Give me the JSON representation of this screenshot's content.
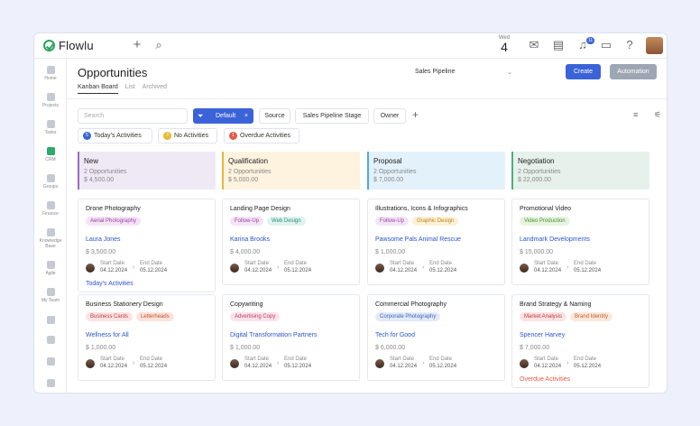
{
  "app": {
    "name": "Flowlu"
  },
  "header": {
    "date_day": "Wed",
    "date_num": "4",
    "notif_count": "11"
  },
  "sidebar": {
    "items": [
      {
        "label": "Home"
      },
      {
        "label": "Projects"
      },
      {
        "label": "Tasks"
      },
      {
        "label": "CRM"
      },
      {
        "label": "Groups"
      },
      {
        "label": "Finance"
      },
      {
        "label": "Knowledge Base"
      },
      {
        "label": "Agile"
      },
      {
        "label": "My Team"
      }
    ]
  },
  "page": {
    "title": "Opportunities",
    "tabs": [
      "Kanban Board",
      "List",
      "Archived"
    ],
    "pipeline": "Sales Pipeline",
    "create_label": "Create",
    "automation_label": "Automation"
  },
  "filters": {
    "search_placeholder": "Search",
    "default_label": "Default",
    "chips": [
      "Source",
      "Sales Pipeline Stage",
      "Owner"
    ]
  },
  "activities": [
    {
      "count": "5",
      "label": "Today's Activities",
      "color": "#3b63d8"
    },
    {
      "count": "3",
      "label": "No Activities",
      "color": "#e5b830"
    },
    {
      "count": "1",
      "label": "Overdue Activities",
      "color": "#e25c4a"
    }
  ],
  "columns": [
    {
      "name": "New",
      "count": "2 Opportunities",
      "total": "$ 4,500.00",
      "bg": "#efe9f6",
      "accent": "#9b6bc8",
      "cards": [
        {
          "title": "Drone Photography",
          "tags": [
            {
              "t": "Aerial Photography",
              "bg": "#f3e4f5",
              "fg": "#9b3fa6"
            }
          ],
          "contact": "Laura Jones",
          "amount": "$ 3,500.00",
          "start": "04.12.2024",
          "end": "05.12.2024",
          "footer": "Today's Activities",
          "footer_color": "#2d55c8"
        },
        {
          "title": "Business Stationery Design",
          "tags": [
            {
              "t": "Business Cards",
              "bg": "#fbe3e3",
              "fg": "#c0393b"
            },
            {
              "t": "Letterheads",
              "bg": "#fbe3dc",
              "fg": "#c04f33"
            }
          ],
          "contact": "Wellness for All",
          "amount": "$ 1,000.00",
          "start": "04.12.2024",
          "end": "05.12.2024",
          "footer": "",
          "footer_color": ""
        }
      ]
    },
    {
      "name": "Qualification",
      "count": "2 Opportunities",
      "total": "$ 5,000.00",
      "bg": "#fdf3de",
      "accent": "#e7b640",
      "cards": [
        {
          "title": "Landing Page Design",
          "tags": [
            {
              "t": "Follow-Up",
              "bg": "#f3e4f5",
              "fg": "#9b3fa6"
            },
            {
              "t": "Web Design",
              "bg": "#dff3ef",
              "fg": "#2a8f7a"
            }
          ],
          "contact": "Karina Brooks",
          "amount": "$ 4,000.00",
          "start": "04.12.2024",
          "end": "05.12.2024",
          "footer": "",
          "footer_color": ""
        },
        {
          "title": "Copywriting",
          "tags": [
            {
              "t": "Advertising Copy",
              "bg": "#fbe3ec",
              "fg": "#c0395e"
            }
          ],
          "contact": "Digital Transformation Partners",
          "amount": "$ 1,000.00",
          "start": "04.12.2024",
          "end": "05.12.2024",
          "footer": "",
          "footer_color": ""
        }
      ]
    },
    {
      "name": "Proposal",
      "count": "2 Opportunities",
      "total": "$ 7,000.00",
      "bg": "#e3f1fa",
      "accent": "#52a8dc",
      "cards": [
        {
          "title": "Illustrations, Icons & Infographics",
          "tags": [
            {
              "t": "Follow-Up",
              "bg": "#f3e4f5",
              "fg": "#9b3fa6"
            },
            {
              "t": "Graphic Design",
              "bg": "#fdf1d6",
              "fg": "#b8861b"
            }
          ],
          "contact": "Pawsome Pals Animal Rescue",
          "amount": "$ 1,000.00",
          "start": "04.12.2024",
          "end": "05.12.2024",
          "footer": "",
          "footer_color": ""
        },
        {
          "title": "Commercial Photography",
          "tags": [
            {
              "t": "Corporate Photography",
              "bg": "#e3eaf8",
              "fg": "#3b63b8"
            }
          ],
          "contact": "Tech for Good",
          "amount": "$ 6,000.00",
          "start": "04.12.2024",
          "end": "05.12.2024",
          "footer": "",
          "footer_color": ""
        }
      ]
    },
    {
      "name": "Negotiation",
      "count": "2 Opportunities",
      "total": "$ 22,000.00",
      "bg": "#e6f1ec",
      "accent": "#4caf7f",
      "cards": [
        {
          "title": "Promotional Video",
          "tags": [
            {
              "t": "Video Production",
              "bg": "#e6f4e0",
              "fg": "#4b8f35"
            }
          ],
          "contact": "Landmark Developments",
          "amount": "$ 15,000.00",
          "start": "04.12.2024",
          "end": "05.12.2024",
          "footer": "",
          "footer_color": ""
        },
        {
          "title": "Brand Strategy & Naming",
          "tags": [
            {
              "t": "Market Analysis",
              "bg": "#fbe3e3",
              "fg": "#c0393b"
            },
            {
              "t": "Brand Identity",
              "bg": "#fbe8dc",
              "fg": "#c0602a"
            }
          ],
          "contact": "Spencer Harvey",
          "amount": "$ 7,000.00",
          "start": "04.12.2024",
          "end": "05.12.2024",
          "footer": "Overdue Activities",
          "footer_color": "#e25c4a"
        }
      ]
    }
  ],
  "card_labels": {
    "start": "Start Date",
    "end": "End Date"
  }
}
